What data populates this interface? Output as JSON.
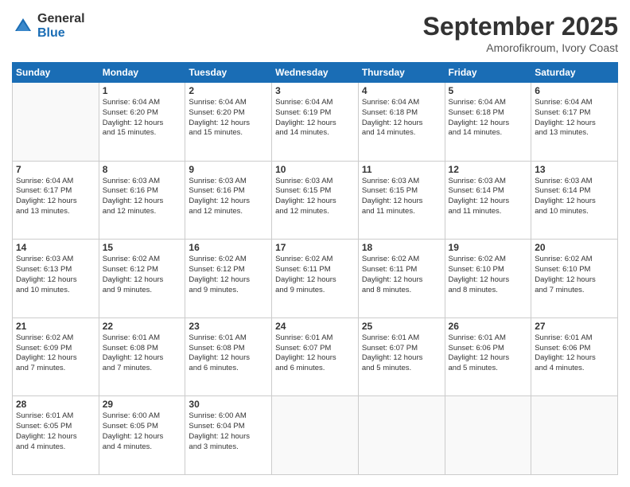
{
  "logo": {
    "general": "General",
    "blue": "Blue"
  },
  "header": {
    "month": "September 2025",
    "location": "Amorofikroum, Ivory Coast"
  },
  "days_of_week": [
    "Sunday",
    "Monday",
    "Tuesday",
    "Wednesday",
    "Thursday",
    "Friday",
    "Saturday"
  ],
  "weeks": [
    [
      {
        "day": "",
        "info": ""
      },
      {
        "day": "1",
        "info": "Sunrise: 6:04 AM\nSunset: 6:20 PM\nDaylight: 12 hours\nand 15 minutes."
      },
      {
        "day": "2",
        "info": "Sunrise: 6:04 AM\nSunset: 6:20 PM\nDaylight: 12 hours\nand 15 minutes."
      },
      {
        "day": "3",
        "info": "Sunrise: 6:04 AM\nSunset: 6:19 PM\nDaylight: 12 hours\nand 14 minutes."
      },
      {
        "day": "4",
        "info": "Sunrise: 6:04 AM\nSunset: 6:18 PM\nDaylight: 12 hours\nand 14 minutes."
      },
      {
        "day": "5",
        "info": "Sunrise: 6:04 AM\nSunset: 6:18 PM\nDaylight: 12 hours\nand 14 minutes."
      },
      {
        "day": "6",
        "info": "Sunrise: 6:04 AM\nSunset: 6:17 PM\nDaylight: 12 hours\nand 13 minutes."
      }
    ],
    [
      {
        "day": "7",
        "info": "Sunrise: 6:04 AM\nSunset: 6:17 PM\nDaylight: 12 hours\nand 13 minutes."
      },
      {
        "day": "8",
        "info": "Sunrise: 6:03 AM\nSunset: 6:16 PM\nDaylight: 12 hours\nand 12 minutes."
      },
      {
        "day": "9",
        "info": "Sunrise: 6:03 AM\nSunset: 6:16 PM\nDaylight: 12 hours\nand 12 minutes."
      },
      {
        "day": "10",
        "info": "Sunrise: 6:03 AM\nSunset: 6:15 PM\nDaylight: 12 hours\nand 12 minutes."
      },
      {
        "day": "11",
        "info": "Sunrise: 6:03 AM\nSunset: 6:15 PM\nDaylight: 12 hours\nand 11 minutes."
      },
      {
        "day": "12",
        "info": "Sunrise: 6:03 AM\nSunset: 6:14 PM\nDaylight: 12 hours\nand 11 minutes."
      },
      {
        "day": "13",
        "info": "Sunrise: 6:03 AM\nSunset: 6:14 PM\nDaylight: 12 hours\nand 10 minutes."
      }
    ],
    [
      {
        "day": "14",
        "info": "Sunrise: 6:03 AM\nSunset: 6:13 PM\nDaylight: 12 hours\nand 10 minutes."
      },
      {
        "day": "15",
        "info": "Sunrise: 6:02 AM\nSunset: 6:12 PM\nDaylight: 12 hours\nand 9 minutes."
      },
      {
        "day": "16",
        "info": "Sunrise: 6:02 AM\nSunset: 6:12 PM\nDaylight: 12 hours\nand 9 minutes."
      },
      {
        "day": "17",
        "info": "Sunrise: 6:02 AM\nSunset: 6:11 PM\nDaylight: 12 hours\nand 9 minutes."
      },
      {
        "day": "18",
        "info": "Sunrise: 6:02 AM\nSunset: 6:11 PM\nDaylight: 12 hours\nand 8 minutes."
      },
      {
        "day": "19",
        "info": "Sunrise: 6:02 AM\nSunset: 6:10 PM\nDaylight: 12 hours\nand 8 minutes."
      },
      {
        "day": "20",
        "info": "Sunrise: 6:02 AM\nSunset: 6:10 PM\nDaylight: 12 hours\nand 7 minutes."
      }
    ],
    [
      {
        "day": "21",
        "info": "Sunrise: 6:02 AM\nSunset: 6:09 PM\nDaylight: 12 hours\nand 7 minutes."
      },
      {
        "day": "22",
        "info": "Sunrise: 6:01 AM\nSunset: 6:08 PM\nDaylight: 12 hours\nand 7 minutes."
      },
      {
        "day": "23",
        "info": "Sunrise: 6:01 AM\nSunset: 6:08 PM\nDaylight: 12 hours\nand 6 minutes."
      },
      {
        "day": "24",
        "info": "Sunrise: 6:01 AM\nSunset: 6:07 PM\nDaylight: 12 hours\nand 6 minutes."
      },
      {
        "day": "25",
        "info": "Sunrise: 6:01 AM\nSunset: 6:07 PM\nDaylight: 12 hours\nand 5 minutes."
      },
      {
        "day": "26",
        "info": "Sunrise: 6:01 AM\nSunset: 6:06 PM\nDaylight: 12 hours\nand 5 minutes."
      },
      {
        "day": "27",
        "info": "Sunrise: 6:01 AM\nSunset: 6:06 PM\nDaylight: 12 hours\nand 4 minutes."
      }
    ],
    [
      {
        "day": "28",
        "info": "Sunrise: 6:01 AM\nSunset: 6:05 PM\nDaylight: 12 hours\nand 4 minutes."
      },
      {
        "day": "29",
        "info": "Sunrise: 6:00 AM\nSunset: 6:05 PM\nDaylight: 12 hours\nand 4 minutes."
      },
      {
        "day": "30",
        "info": "Sunrise: 6:00 AM\nSunset: 6:04 PM\nDaylight: 12 hours\nand 3 minutes."
      },
      {
        "day": "",
        "info": ""
      },
      {
        "day": "",
        "info": ""
      },
      {
        "day": "",
        "info": ""
      },
      {
        "day": "",
        "info": ""
      }
    ]
  ]
}
